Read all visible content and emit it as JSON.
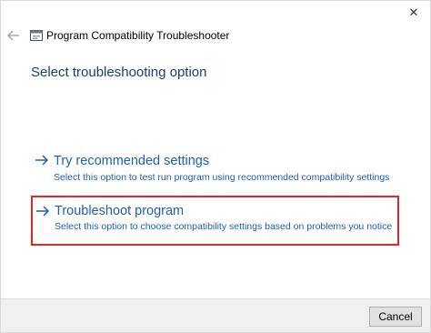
{
  "window": {
    "title": "Program Compatibility Troubleshooter",
    "close_glyph": "✕",
    "back_icon": "back-arrow-icon",
    "app_icon": "troubleshooter-icon"
  },
  "main": {
    "heading": "Select troubleshooting option",
    "options": [
      {
        "title": "Try recommended settings",
        "description": "Select this option to test run program using recommended compatibility settings",
        "icon": "arrow-right-icon",
        "highlighted": false
      },
      {
        "title": "Troubleshoot program",
        "description": "Select this option to choose compatibility settings based on problems you notice",
        "icon": "arrow-right-icon",
        "highlighted": true
      }
    ]
  },
  "footer": {
    "cancel_label": "Cancel"
  },
  "colors": {
    "link_blue": "#1f5fb0",
    "heading_blue": "#1a3e75",
    "highlight_red": "#e0272b",
    "footer_bg": "#f0f0f0"
  }
}
